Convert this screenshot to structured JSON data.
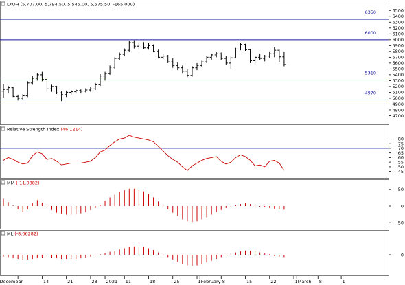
{
  "chart_data": [
    {
      "type": "ohlc",
      "header": {
        "symbol": "LKOH",
        "ohlc": "(5,707.00, 5,794.50, 5,545.00, 5,575.50, -165.000)"
      },
      "ylim": [
        4600,
        6550
      ],
      "yticks": [
        4700,
        4800,
        4900,
        5000,
        5100,
        5200,
        5300,
        5400,
        5500,
        5600,
        5700,
        5800,
        5900,
        6000,
        6100,
        6200,
        6300,
        6400,
        6500
      ],
      "levels": [
        {
          "value": 6350,
          "label": "6350"
        },
        {
          "value": 6000,
          "label": "6000"
        },
        {
          "value": 5310,
          "label": "5310"
        },
        {
          "value": 4970,
          "label": "4970"
        }
      ],
      "bars": [
        {
          "o": 5120,
          "h": 5240,
          "l": 5010,
          "c": 5150
        },
        {
          "o": 5150,
          "h": 5210,
          "l": 5080,
          "c": 5180
        },
        {
          "o": 5180,
          "h": 5190,
          "l": 5020,
          "c": 5030
        },
        {
          "o": 5030,
          "h": 5060,
          "l": 4960,
          "c": 5000
        },
        {
          "o": 5000,
          "h": 5070,
          "l": 4970,
          "c": 5040
        },
        {
          "o": 5040,
          "h": 5290,
          "l": 5020,
          "c": 5260
        },
        {
          "o": 5260,
          "h": 5380,
          "l": 5230,
          "c": 5340
        },
        {
          "o": 5340,
          "h": 5430,
          "l": 5300,
          "c": 5400
        },
        {
          "o": 5400,
          "h": 5450,
          "l": 5290,
          "c": 5320
        },
        {
          "o": 5320,
          "h": 5330,
          "l": 5130,
          "c": 5160
        },
        {
          "o": 5160,
          "h": 5230,
          "l": 5110,
          "c": 5200
        },
        {
          "o": 5200,
          "h": 5210,
          "l": 5070,
          "c": 5090
        },
        {
          "o": 5090,
          "h": 5120,
          "l": 4950,
          "c": 5060
        },
        {
          "o": 5060,
          "h": 5130,
          "l": 5020,
          "c": 5100
        },
        {
          "o": 5100,
          "h": 5140,
          "l": 5060,
          "c": 5110
        },
        {
          "o": 5110,
          "h": 5160,
          "l": 5080,
          "c": 5130
        },
        {
          "o": 5130,
          "h": 5150,
          "l": 5080,
          "c": 5120
        },
        {
          "o": 5120,
          "h": 5170,
          "l": 5100,
          "c": 5140
        },
        {
          "o": 5140,
          "h": 5190,
          "l": 5110,
          "c": 5160
        },
        {
          "o": 5160,
          "h": 5260,
          "l": 5140,
          "c": 5230
        },
        {
          "o": 5230,
          "h": 5410,
          "l": 5210,
          "c": 5380
        },
        {
          "o": 5380,
          "h": 5450,
          "l": 5300,
          "c": 5420
        },
        {
          "o": 5420,
          "h": 5560,
          "l": 5400,
          "c": 5530
        },
        {
          "o": 5530,
          "h": 5700,
          "l": 5500,
          "c": 5680
        },
        {
          "o": 5680,
          "h": 5780,
          "l": 5650,
          "c": 5750
        },
        {
          "o": 5750,
          "h": 5850,
          "l": 5720,
          "c": 5820
        },
        {
          "o": 5820,
          "h": 5980,
          "l": 5800,
          "c": 5950
        },
        {
          "o": 5950,
          "h": 5990,
          "l": 5850,
          "c": 5890
        },
        {
          "o": 5890,
          "h": 5940,
          "l": 5830,
          "c": 5910
        },
        {
          "o": 5910,
          "h": 5960,
          "l": 5840,
          "c": 5860
        },
        {
          "o": 5860,
          "h": 5940,
          "l": 5830,
          "c": 5900
        },
        {
          "o": 5900,
          "h": 5920,
          "l": 5790,
          "c": 5800
        },
        {
          "o": 5800,
          "h": 5830,
          "l": 5680,
          "c": 5700
        },
        {
          "o": 5700,
          "h": 5760,
          "l": 5660,
          "c": 5720
        },
        {
          "o": 5720,
          "h": 5740,
          "l": 5600,
          "c": 5620
        },
        {
          "o": 5620,
          "h": 5680,
          "l": 5520,
          "c": 5560
        },
        {
          "o": 5560,
          "h": 5610,
          "l": 5480,
          "c": 5520
        },
        {
          "o": 5520,
          "h": 5560,
          "l": 5420,
          "c": 5460
        },
        {
          "o": 5460,
          "h": 5490,
          "l": 5360,
          "c": 5390
        },
        {
          "o": 5390,
          "h": 5550,
          "l": 5370,
          "c": 5520
        },
        {
          "o": 5520,
          "h": 5600,
          "l": 5480,
          "c": 5560
        },
        {
          "o": 5560,
          "h": 5640,
          "l": 5540,
          "c": 5620
        },
        {
          "o": 5620,
          "h": 5720,
          "l": 5600,
          "c": 5700
        },
        {
          "o": 5700,
          "h": 5760,
          "l": 5660,
          "c": 5740
        },
        {
          "o": 5740,
          "h": 5790,
          "l": 5700,
          "c": 5760
        },
        {
          "o": 5760,
          "h": 5780,
          "l": 5650,
          "c": 5680
        },
        {
          "o": 5680,
          "h": 5720,
          "l": 5570,
          "c": 5600
        },
        {
          "o": 5600,
          "h": 5710,
          "l": 5500,
          "c": 5690
        },
        {
          "o": 5690,
          "h": 5860,
          "l": 5680,
          "c": 5840
        },
        {
          "o": 5840,
          "h": 5940,
          "l": 5820,
          "c": 5920
        },
        {
          "o": 5920,
          "h": 5930,
          "l": 5810,
          "c": 5830
        },
        {
          "o": 5830,
          "h": 5840,
          "l": 5600,
          "c": 5640
        },
        {
          "o": 5640,
          "h": 5730,
          "l": 5590,
          "c": 5700
        },
        {
          "o": 5700,
          "h": 5760,
          "l": 5650,
          "c": 5680
        },
        {
          "o": 5680,
          "h": 5740,
          "l": 5630,
          "c": 5720
        },
        {
          "o": 5720,
          "h": 5800,
          "l": 5690,
          "c": 5760
        },
        {
          "o": 5760,
          "h": 5880,
          "l": 5700,
          "c": 5820
        },
        {
          "o": 5820,
          "h": 5830,
          "l": 5620,
          "c": 5707
        },
        {
          "o": 5707,
          "h": 5794.5,
          "l": 5545,
          "c": 5575.5
        }
      ]
    },
    {
      "type": "line",
      "header": {
        "title": "Relative Strength Index",
        "value": "(46.1214)"
      },
      "ylim": [
        41,
        87
      ],
      "yticks": [
        45,
        50,
        55,
        60,
        65,
        70,
        75,
        80
      ],
      "levels": [
        70
      ],
      "values": [
        57,
        60,
        58,
        55,
        53,
        54,
        62,
        66,
        64,
        58,
        59,
        56,
        52,
        53,
        54,
        54,
        54,
        55,
        56,
        60,
        66,
        68,
        73,
        77,
        80,
        81,
        84,
        82,
        81,
        80,
        79,
        77,
        72,
        67,
        62,
        58,
        55,
        50,
        46,
        51,
        54,
        57,
        59,
        60,
        61,
        56,
        53,
        55,
        60,
        63,
        61,
        57,
        51,
        52,
        50,
        56,
        57,
        54,
        46.1214
      ]
    },
    {
      "type": "bar",
      "header": {
        "title": "MM",
        "value": "(-11.0882)"
      },
      "ylim": [
        -60,
        60
      ],
      "yticks": [
        -50,
        0,
        50
      ],
      "values": [
        22,
        12,
        2,
        -10,
        -18,
        -10,
        8,
        18,
        10,
        -2,
        -12,
        -20,
        -24,
        -26,
        -26,
        -25,
        -22,
        -18,
        -12,
        -6,
        4,
        16,
        26,
        34,
        42,
        48,
        52,
        52,
        50,
        44,
        36,
        26,
        14,
        2,
        -10,
        -20,
        -30,
        -40,
        -46,
        -48,
        -46,
        -40,
        -34,
        -26,
        -18,
        -12,
        -6,
        -2,
        2,
        6,
        8,
        6,
        2,
        -2,
        -4,
        -6,
        -8,
        -10,
        -11.0882
      ]
    },
    {
      "type": "bar",
      "header": {
        "title": "ML",
        "value": "(-8.06282)"
      },
      "ylim": [
        -60,
        60
      ],
      "yticks": [
        0
      ],
      "values": [
        -6,
        -8,
        -12,
        -14,
        -16,
        -16,
        -14,
        -12,
        -10,
        -10,
        -10,
        -12,
        -14,
        -14,
        -14,
        -14,
        -12,
        -10,
        -6,
        -2,
        2,
        6,
        10,
        14,
        18,
        22,
        26,
        28,
        28,
        26,
        22,
        16,
        8,
        0,
        -8,
        -16,
        -24,
        -30,
        -36,
        -38,
        -36,
        -32,
        -26,
        -20,
        -14,
        -8,
        -2,
        4,
        8,
        12,
        14,
        14,
        12,
        8,
        4,
        0,
        -4,
        -6,
        -8.06282
      ]
    }
  ],
  "xaxis": {
    "labels": [
      {
        "bar": -1,
        "text": "December"
      },
      {
        "bar": 3,
        "text": "7"
      },
      {
        "bar": 8,
        "text": "14"
      },
      {
        "bar": 13,
        "text": "21"
      },
      {
        "bar": 18,
        "text": "28"
      },
      {
        "bar": 21,
        "text": "2021"
      },
      {
        "bar": 25,
        "text": "11"
      },
      {
        "bar": 30,
        "text": "18"
      },
      {
        "bar": 35,
        "text": "25"
      },
      {
        "bar": 40,
        "text": "1"
      },
      {
        "bar": 40.6,
        "text": "February"
      },
      {
        "bar": 45,
        "text": "8"
      },
      {
        "bar": 50,
        "text": "15"
      },
      {
        "bar": 55,
        "text": "22"
      },
      {
        "bar": 60,
        "text": "1"
      },
      {
        "bar": 60.6,
        "text": "March"
      },
      {
        "bar": 65,
        "text": "8"
      },
      {
        "bar": 69.8,
        "text": "1"
      }
    ]
  },
  "colors": {
    "price_bar": "#000000",
    "indicator": "#cc0000",
    "level_line": "#1a1aa0",
    "level_text": "#1a1aa0",
    "panel_border": "#808080",
    "background": "#ffffff"
  }
}
